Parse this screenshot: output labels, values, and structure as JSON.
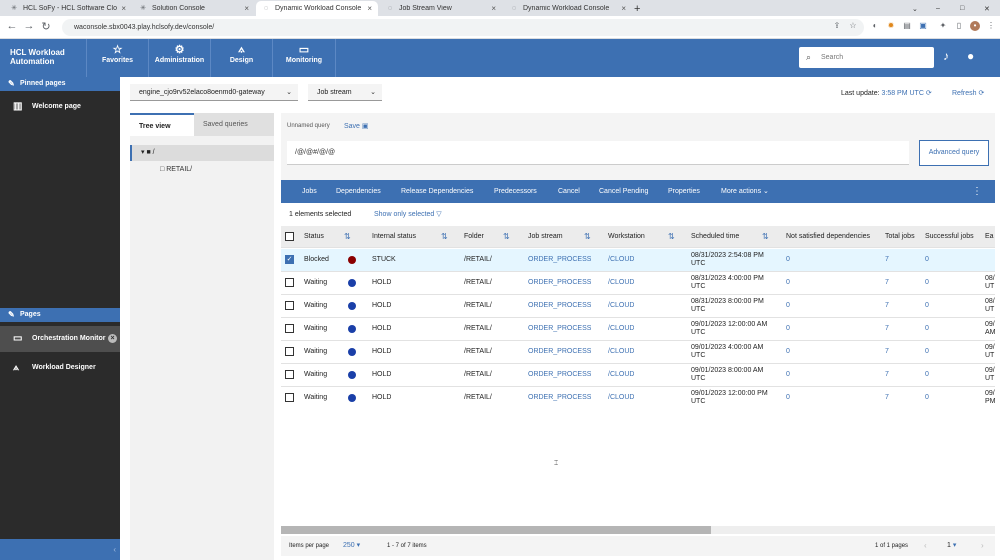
{
  "browser": {
    "tabs": [
      {
        "label": "HCL SoFy - HCL Software Cloud N",
        "active": false
      },
      {
        "label": "Solution Console",
        "active": false
      },
      {
        "label": "Dynamic Workload Console",
        "active": true
      },
      {
        "label": "Job Stream View",
        "active": false
      },
      {
        "label": "Dynamic Workload Console",
        "active": false
      }
    ],
    "url": "waconsole.sbx0043.play.hclsofy.dev/console/"
  },
  "app": {
    "brand_line1": "HCL Workload",
    "brand_line2": "Automation",
    "nav": [
      "Favorites",
      "Administration",
      "Design",
      "Monitoring"
    ],
    "search_placeholder": "Search"
  },
  "rail": {
    "pinned_header": "Pinned pages",
    "pinned": [
      "Welcome page"
    ],
    "pages_header": "Pages",
    "pages": [
      "Orchestration Monitor",
      "Workload Designer"
    ]
  },
  "toolbar": {
    "engine": "engine_cjo9rv52elaco8oenmd0-gateway",
    "object_type": "Job stream",
    "last_update_label": "Last update:",
    "last_update_time": "3:58 PM UTC",
    "refresh_label": "Refresh"
  },
  "tree": {
    "tabs": [
      "Tree view",
      "Saved queries"
    ],
    "root": "/",
    "child": "RETAIL/"
  },
  "query": {
    "name": "Unnamed query",
    "save_label": "Save",
    "text": "/@/@#/@/@",
    "advanced_label": "Advanced query"
  },
  "actions": [
    "Jobs",
    "Dependencies",
    "Release Dependencies",
    "Predecessors",
    "Cancel",
    "Cancel Pending",
    "Properties",
    "More actions"
  ],
  "selection": {
    "count_text": "1 elements selected",
    "show_only_label": "Show only selected"
  },
  "table": {
    "columns": [
      "Status",
      "Internal status",
      "Folder",
      "Job stream",
      "Workstation",
      "Scheduled time",
      "Not satisfied dependencies",
      "Total jobs",
      "Successful jobs",
      "Ea"
    ],
    "rows": [
      {
        "selected": true,
        "status": "Blocked",
        "status_color": "#8b0000",
        "internal": "STUCK",
        "folder": "/RETAIL/",
        "jobstream": "ORDER_PROCESS",
        "workstation": "/CLOUD",
        "time1": "08/31/2023 2:54:08 PM",
        "time2": "UTC",
        "notsat": "0",
        "total": "7",
        "success": "0",
        "early1": "",
        "early2": ""
      },
      {
        "selected": false,
        "status": "Waiting",
        "status_color": "#1a3fa8",
        "internal": "HOLD",
        "folder": "/RETAIL/",
        "jobstream": "ORDER_PROCESS",
        "workstation": "/CLOUD",
        "time1": "08/31/2023 4:00:00 PM",
        "time2": "UTC",
        "notsat": "0",
        "total": "7",
        "success": "0",
        "early1": "08/",
        "early2": "UT"
      },
      {
        "selected": false,
        "status": "Waiting",
        "status_color": "#1a3fa8",
        "internal": "HOLD",
        "folder": "/RETAIL/",
        "jobstream": "ORDER_PROCESS",
        "workstation": "/CLOUD",
        "time1": "08/31/2023 8:00:00 PM",
        "time2": "UTC",
        "notsat": "0",
        "total": "7",
        "success": "0",
        "early1": "08/",
        "early2": "UT"
      },
      {
        "selected": false,
        "status": "Waiting",
        "status_color": "#1a3fa8",
        "internal": "HOLD",
        "folder": "/RETAIL/",
        "jobstream": "ORDER_PROCESS",
        "workstation": "/CLOUD",
        "time1": "09/01/2023 12:00:00 AM",
        "time2": "UTC",
        "notsat": "0",
        "total": "7",
        "success": "0",
        "early1": "09/",
        "early2": "AM"
      },
      {
        "selected": false,
        "status": "Waiting",
        "status_color": "#1a3fa8",
        "internal": "HOLD",
        "folder": "/RETAIL/",
        "jobstream": "ORDER_PROCESS",
        "workstation": "/CLOUD",
        "time1": "09/01/2023 4:00:00 AM",
        "time2": "UTC",
        "notsat": "0",
        "total": "7",
        "success": "0",
        "early1": "09/",
        "early2": "UT"
      },
      {
        "selected": false,
        "status": "Waiting",
        "status_color": "#1a3fa8",
        "internal": "HOLD",
        "folder": "/RETAIL/",
        "jobstream": "ORDER_PROCESS",
        "workstation": "/CLOUD",
        "time1": "09/01/2023 8:00:00 AM",
        "time2": "UTC",
        "notsat": "0",
        "total": "7",
        "success": "0",
        "early1": "09/",
        "early2": "UT"
      },
      {
        "selected": false,
        "status": "Waiting",
        "status_color": "#1a3fa8",
        "internal": "HOLD",
        "folder": "/RETAIL/",
        "jobstream": "ORDER_PROCESS",
        "workstation": "/CLOUD",
        "time1": "09/01/2023 12:00:00 PM",
        "time2": "UTC",
        "notsat": "0",
        "total": "7",
        "success": "0",
        "early1": "09/",
        "early2": "PM"
      }
    ]
  },
  "pagination": {
    "per_page_label": "Items per page",
    "per_page": "250",
    "range": "1 - 7 of 7 items",
    "pages_text": "1 of 1 pages",
    "current_page": "1"
  },
  "colors": {
    "brand": "#3d70b2",
    "rail": "#2b2b2b",
    "blocked": "#8b0000",
    "waiting": "#1a3fa8"
  }
}
